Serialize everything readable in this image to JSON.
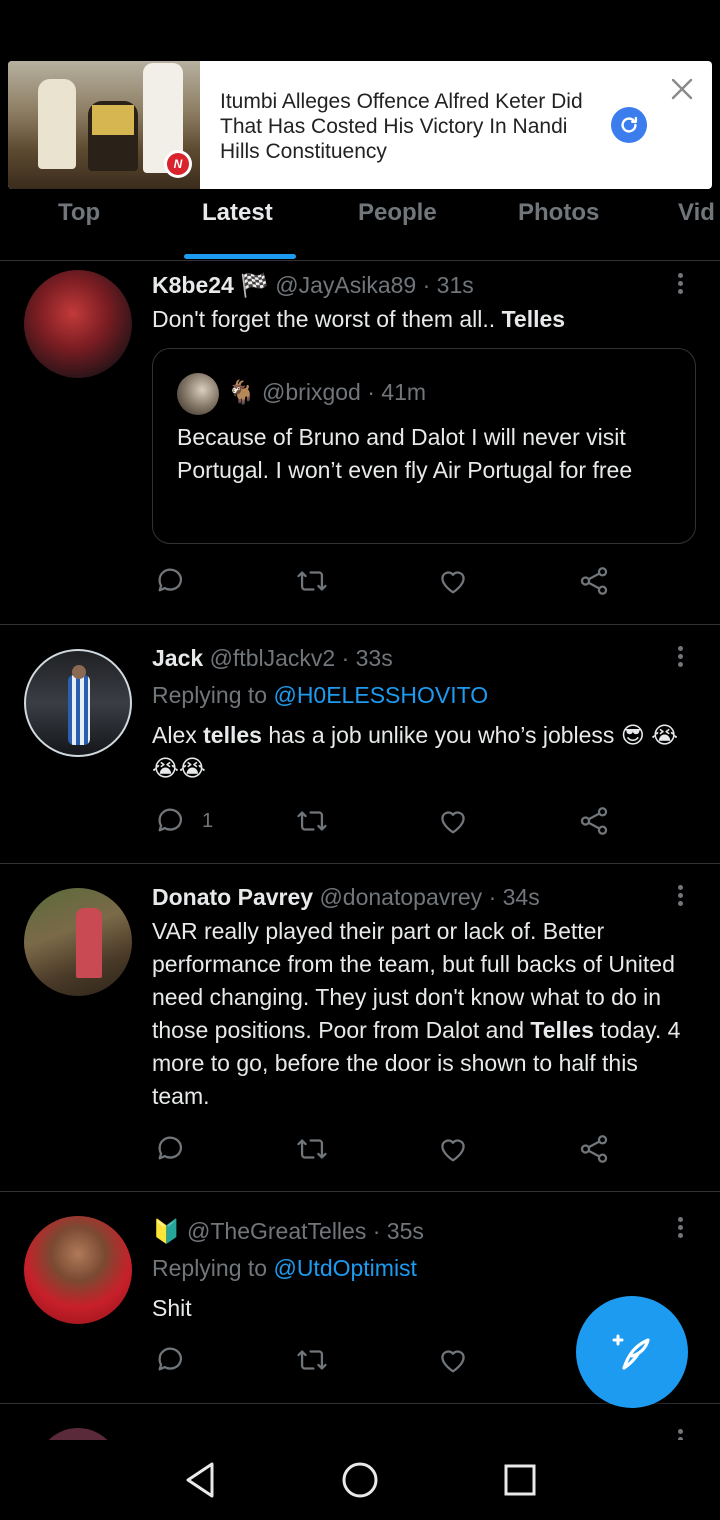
{
  "ad": {
    "headline": "Itumbi Alleges Offence Alfred Keter Did That Has Costed His Victory In Nandi Hills Constituency",
    "badge_letter": "N",
    "refresh_icon": "refresh-icon",
    "close_icon": "close-icon"
  },
  "tabs": [
    {
      "label": "Top",
      "active": false
    },
    {
      "label": "Latest",
      "active": true
    },
    {
      "label": "People",
      "active": false
    },
    {
      "label": "Photos",
      "active": false
    },
    {
      "label": "Vid",
      "active": false
    }
  ],
  "tweets": [
    {
      "name": "K8be24",
      "name_emoji": "🏁",
      "handle": "@JayAsika89",
      "time": "31s",
      "text_plain": "Don't forget the worst of them all.. ",
      "text_bold": "Telles",
      "quote": {
        "emoji": "🐐",
        "handle": "@brixgod",
        "time": "41m",
        "text": "Because of Bruno and Dalot I will never visit Portugal. I won’t even fly Air Portugal for free"
      },
      "reply_count": ""
    },
    {
      "name": "Jack",
      "handle": "@ftblJackv2",
      "time": "33s",
      "replying_prefix": "Replying to ",
      "replying_to": "@H0ELESSHOVITO",
      "text_a": "Alex ",
      "text_bold": "telles",
      "text_b": " has a job unlike you who’s jobless 😎 😭😭😭",
      "reply_count": "1"
    },
    {
      "name": "Donato Pavrey",
      "handle": "@donatopavrey",
      "time": "34s",
      "text_a": "VAR really played their part or lack of. Better performance from the team, but full backs of United need changing. They just don't know what to do in those positions. Poor from Dalot and ",
      "text_bold": "Telles",
      "text_b": " today. 4 more to go, before the door is shown to half this team.",
      "reply_count": ""
    },
    {
      "name_emoji": "🔰",
      "handle": "@TheGreatTelles",
      "time": "35s",
      "replying_prefix": "Replying to ",
      "replying_to": "@UtdOptimist",
      "text": "Shit",
      "reply_count": ""
    }
  ],
  "sep": " · ",
  "icons": {
    "reply": "reply-icon",
    "retweet": "retweet-icon",
    "like": "heart-icon",
    "share": "share-icon",
    "compose": "compose-tweet-icon",
    "nav_back": "nav-back-icon",
    "nav_home": "nav-home-icon",
    "nav_recents": "nav-recents-icon"
  },
  "colors": {
    "accent": "#1d9bf0",
    "muted": "#71767b",
    "text": "#e7e9ea",
    "background": "#000000"
  }
}
